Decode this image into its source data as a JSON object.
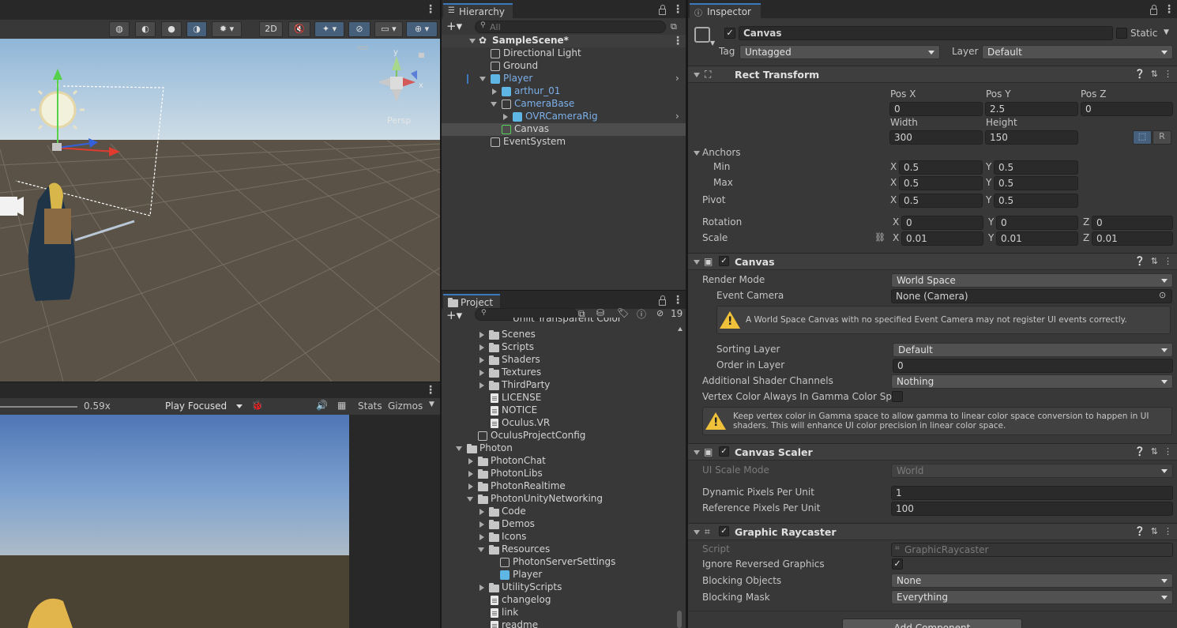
{
  "scene_view": {
    "toolbar": {
      "btn_2d": "2D",
      "persp_label": "Persp"
    }
  },
  "game_view": {
    "scale_value": "0.59x",
    "play_mode": "Play Focused",
    "stats_label": "Stats",
    "gizmos_label": "Gizmos"
  },
  "hierarchy": {
    "tab_label": "Hierarchy",
    "search_placeholder": "All",
    "items": [
      {
        "label": "SampleScene*"
      },
      {
        "label": "Directional Light"
      },
      {
        "label": "Ground"
      },
      {
        "label": "Player"
      },
      {
        "label": "arthur_01"
      },
      {
        "label": "CameraBase"
      },
      {
        "label": "OVRCameraRig"
      },
      {
        "label": "Canvas"
      },
      {
        "label": "EventSystem"
      }
    ]
  },
  "project": {
    "tab_label": "Project",
    "hidden_count": "19",
    "items": [
      {
        "label": "Unlit Transparent Color"
      },
      {
        "label": "Scenes"
      },
      {
        "label": "Scripts"
      },
      {
        "label": "Shaders"
      },
      {
        "label": "Textures"
      },
      {
        "label": "ThirdParty"
      },
      {
        "label": "LICENSE"
      },
      {
        "label": "NOTICE"
      },
      {
        "label": "Oculus.VR"
      },
      {
        "label": "OculusProjectConfig"
      },
      {
        "label": "Photon"
      },
      {
        "label": "PhotonChat"
      },
      {
        "label": "PhotonLibs"
      },
      {
        "label": "PhotonRealtime"
      },
      {
        "label": "PhotonUnityNetworking"
      },
      {
        "label": "Code"
      },
      {
        "label": "Demos"
      },
      {
        "label": "Icons"
      },
      {
        "label": "Resources"
      },
      {
        "label": "PhotonServerSettings"
      },
      {
        "label": "Player"
      },
      {
        "label": "UtilityScripts"
      },
      {
        "label": "changelog"
      },
      {
        "label": "link"
      },
      {
        "label": "readme"
      }
    ]
  },
  "inspector": {
    "tab_label": "Inspector",
    "object_name": "Canvas",
    "static_label": "Static",
    "tag_label": "Tag",
    "tag_value": "Untagged",
    "layer_label": "Layer",
    "layer_value": "Default",
    "rect_transform": {
      "title": "Rect Transform",
      "pos_x_label": "Pos X",
      "pos_x": "0",
      "pos_y_label": "Pos Y",
      "pos_y": "2.5",
      "pos_z_label": "Pos Z",
      "pos_z": "0",
      "width_label": "Width",
      "width": "300",
      "height_label": "Height",
      "height": "150",
      "r_label": "R",
      "anchors_label": "Anchors",
      "min_label": "Min",
      "min_x": "0.5",
      "min_y": "0.5",
      "max_label": "Max",
      "max_x": "0.5",
      "max_y": "0.5",
      "pivot_label": "Pivot",
      "pivot_x": "0.5",
      "pivot_y": "0.5",
      "rotation_label": "Rotation",
      "rot_x": "0",
      "rot_y": "0",
      "rot_z": "0",
      "scale_label": "Scale",
      "scale_x": "0.01",
      "scale_y": "0.01",
      "scale_z": "0.01",
      "x": "X",
      "y": "Y",
      "z": "Z"
    },
    "canvas": {
      "title": "Canvas",
      "render_mode_label": "Render Mode",
      "render_mode": "World Space",
      "event_camera_label": "Event Camera",
      "event_camera": "None (Camera)",
      "warning1": "A World Space Canvas with no specified Event Camera may not register UI events correctly.",
      "sorting_layer_label": "Sorting Layer",
      "sorting_layer": "Default",
      "order_label": "Order in Layer",
      "order": "0",
      "shader_channels_label": "Additional Shader Channels",
      "shader_channels": "Nothing",
      "vertex_color_label": "Vertex Color Always In Gamma Color Spac",
      "warning2": "Keep vertex color in Gamma space to allow gamma to linear color space conversion to happen in UI shaders. This will enhance UI color precision in linear color space."
    },
    "canvas_scaler": {
      "title": "Canvas Scaler",
      "ui_scale_label": "UI Scale Mode",
      "ui_scale": "World",
      "dyn_label": "Dynamic Pixels Per Unit",
      "dyn": "1",
      "ref_label": "Reference Pixels Per Unit",
      "ref": "100"
    },
    "graphic_raycaster": {
      "title": "Graphic Raycaster",
      "script_label": "Script",
      "script": "GraphicRaycaster",
      "ignore_label": "Ignore Reversed Graphics",
      "blocking_objects_label": "Blocking Objects",
      "blocking_objects": "None",
      "blocking_mask_label": "Blocking Mask",
      "blocking_mask": "Everything"
    },
    "add_component": "Add Component"
  },
  "colors": {
    "accent": "#3a79bb",
    "prefab_blue": "#7cb0ea",
    "warning": "#f0c23a",
    "panel_bg": "#383838"
  }
}
